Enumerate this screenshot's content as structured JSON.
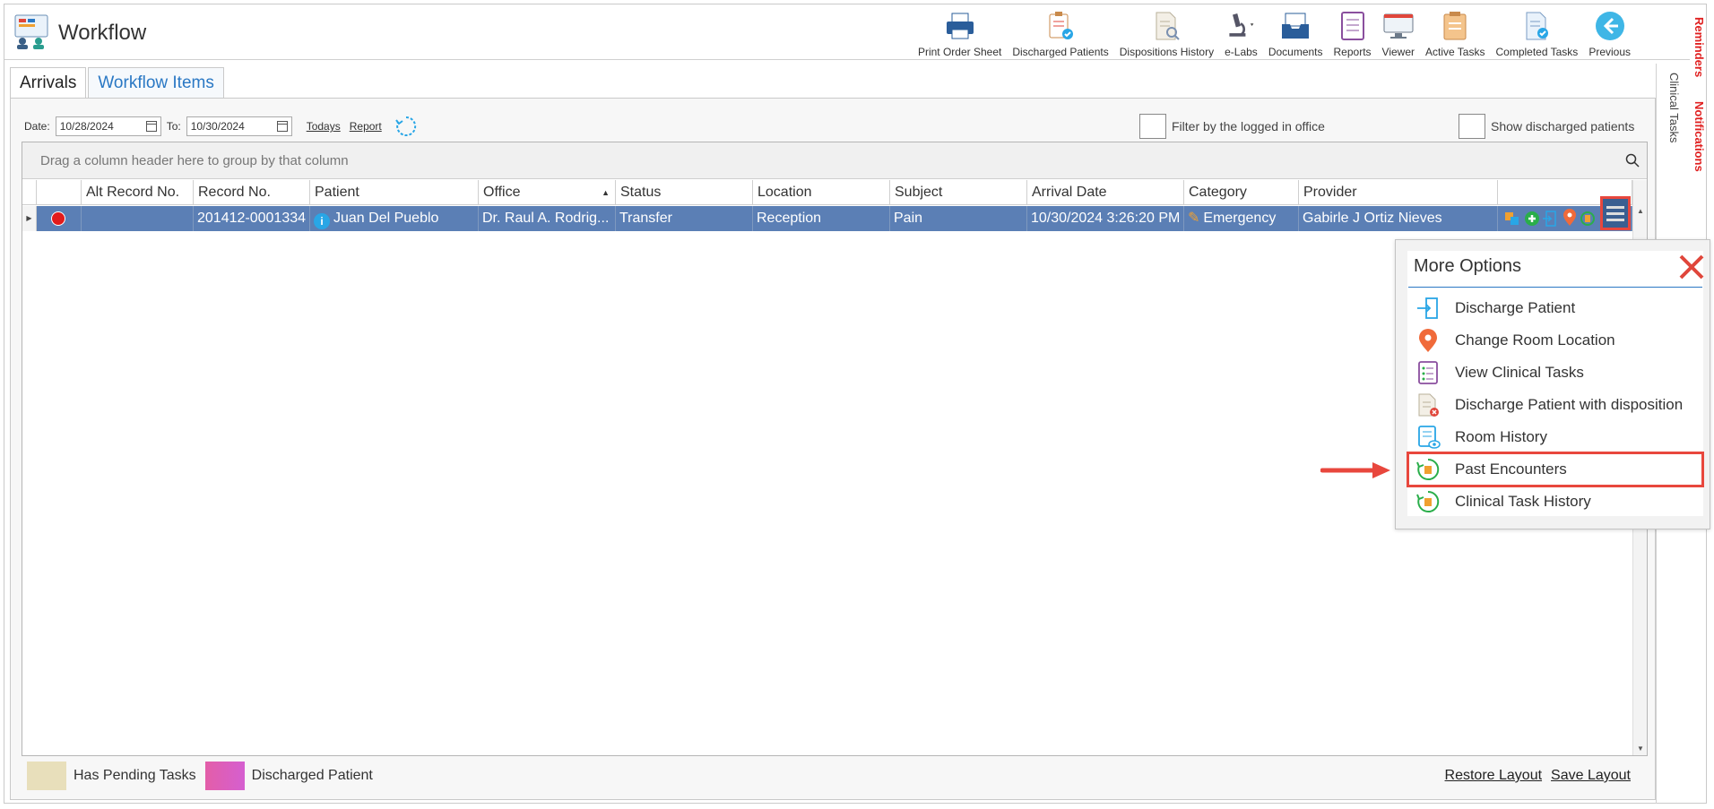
{
  "app": {
    "title": "Workflow"
  },
  "toolbar": [
    {
      "label": "Print Order Sheet",
      "icon": "printer-icon"
    },
    {
      "label": "Discharged Patients",
      "icon": "clipboard-check-icon"
    },
    {
      "label": "Dispositions History",
      "icon": "document-search-icon"
    },
    {
      "label": "e-Labs",
      "icon": "microscope-icon"
    },
    {
      "label": "Documents",
      "icon": "inbox-tray-icon"
    },
    {
      "label": "Reports",
      "icon": "report-icon"
    },
    {
      "label": "Viewer",
      "icon": "monitor-icon"
    },
    {
      "label": "Active Tasks",
      "icon": "active-tasks-icon"
    },
    {
      "label": "Completed Tasks",
      "icon": "completed-tasks-icon"
    },
    {
      "label": "Previous",
      "icon": "back-arrow-icon"
    }
  ],
  "side": {
    "reminders": "Reminders",
    "notifications": "Notifications",
    "clinical_tasks": "Clinical Tasks"
  },
  "tabs": [
    {
      "label": "Arrivals",
      "active": true
    },
    {
      "label": "Workflow Items",
      "active": false
    }
  ],
  "filters": {
    "date_label": "Date:",
    "date_from": "10/28/2024",
    "to_label": "To:",
    "date_to": "10/30/2024",
    "todays": "Todays",
    "report": "Report",
    "filter_office": "Filter by the logged in office",
    "show_discharged": "Show discharged patients"
  },
  "grid": {
    "group_hint": "Drag a column header here to group by that column",
    "columns": [
      "Alt Record No.",
      "Record No.",
      "Patient",
      "Office",
      "Status",
      "Location",
      "Subject",
      "Arrival Date",
      "Category",
      "Provider"
    ],
    "rows": [
      {
        "alt_record": "",
        "record": "201412-0001334",
        "patient": "Juan Del Pueblo",
        "office": "Dr. Raul A. Rodrig...",
        "status": "Transfer",
        "location": "Reception",
        "subject": "Pain",
        "arrival": "10/30/2024 3:26:20 PM",
        "category": "Emergency",
        "provider": "Gabirle J Ortiz Nieves"
      }
    ]
  },
  "popup": {
    "title": "More Options",
    "items": [
      {
        "label": "Discharge Patient",
        "icon": "discharge-icon"
      },
      {
        "label": "Change Room Location",
        "icon": "location-pin-icon"
      },
      {
        "label": "View Clinical Tasks",
        "icon": "task-list-icon"
      },
      {
        "label": "Discharge Patient with disposition",
        "icon": "document-x-icon"
      },
      {
        "label": "Room History",
        "icon": "room-history-icon"
      },
      {
        "label": "Past Encounters",
        "icon": "history-icon",
        "highlighted": true
      },
      {
        "label": "Clinical Task History",
        "icon": "history-icon"
      }
    ]
  },
  "legend": [
    {
      "label": "Has Pending Tasks",
      "color": "#e8dfbb"
    },
    {
      "label": "Discharged Patient",
      "color": "#e35ea8"
    }
  ],
  "footer": {
    "restore": "Restore Layout",
    "save": "Save Layout"
  },
  "colors": {
    "accent": "#2a78c4",
    "selected_row": "#5b7fb5",
    "highlight": "#e8473d"
  }
}
